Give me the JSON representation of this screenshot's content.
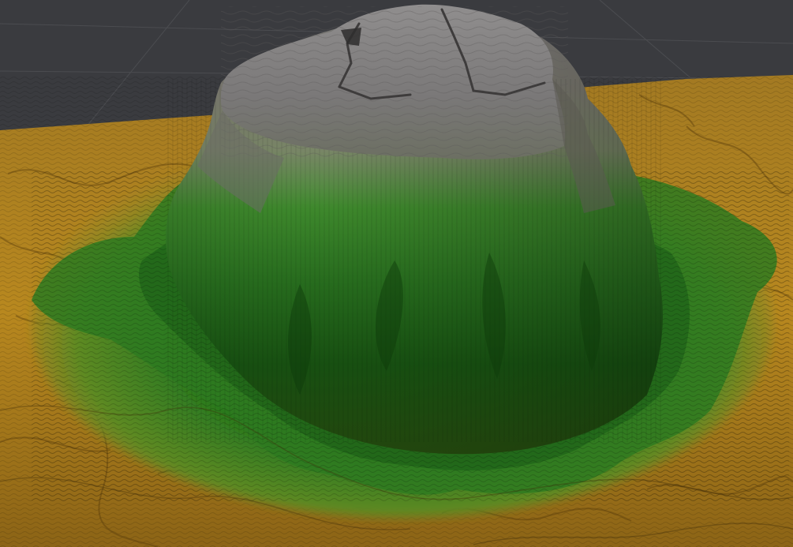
{
  "viewport": {
    "background_color": "#3a3b3f",
    "grid_line_color": "#4b4c50"
  },
  "terrain": {
    "type": "heightmap-3d",
    "color_ramp": {
      "low": "#b8871f",
      "low_mid": "#9c7a1c",
      "mid": "#3f8a25",
      "mid_high": "#1e6d1a",
      "high": "#8e8c80",
      "peak": "#8a8888"
    },
    "features": [
      "mesa",
      "plateau",
      "terraced-slopes",
      "surrounding-plain"
    ]
  }
}
